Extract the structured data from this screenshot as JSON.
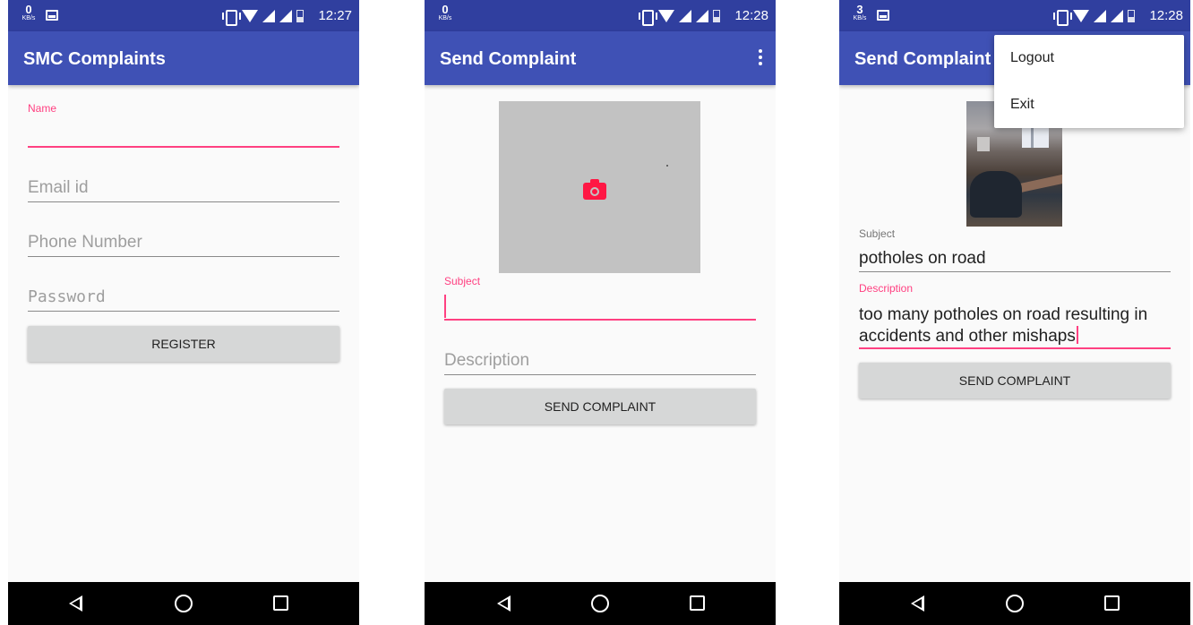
{
  "status_bar": {
    "kbs_unit": "KB/s",
    "screen1": {
      "kbs": "0",
      "time": "12:27"
    },
    "screen2": {
      "kbs": "0",
      "time": "12:28"
    },
    "screen3": {
      "kbs": "3",
      "time": "12:28"
    }
  },
  "screen1": {
    "title": "SMC Complaints",
    "name_label": "Name",
    "email_hint": "Email id",
    "phone_hint": "Phone Number",
    "password_hint": "Password",
    "register_label": "REGISTER"
  },
  "screen2": {
    "title": "Send Complaint",
    "subject_label": "Subject",
    "description_hint": "Description",
    "send_label": "SEND COMPLAINT"
  },
  "screen3": {
    "title": "Send Complaint",
    "menu": {
      "logout": "Logout",
      "exit": "Exit"
    },
    "subject_label": "Subject",
    "subject_value": "potholes on road",
    "description_label": "Description",
    "description_line1": "too many potholes on road resulting in",
    "description_line2": "accidents and other mishaps",
    "send_label": "SEND COMPLAINT"
  },
  "icons": {
    "status": [
      "image-notification-icon",
      "vibrate-icon",
      "wifi-icon",
      "cell-signal-icon",
      "battery-icon"
    ],
    "nav": [
      "back-icon",
      "home-icon",
      "recents-icon"
    ],
    "overflow": "more-vert-icon",
    "camera": "camera-icon"
  },
  "colors": {
    "primary": "#3f51b5",
    "primary_dark": "#303f9f",
    "accent": "#ff4081",
    "camera": "#ff1744",
    "button": "#d6d7d7"
  }
}
